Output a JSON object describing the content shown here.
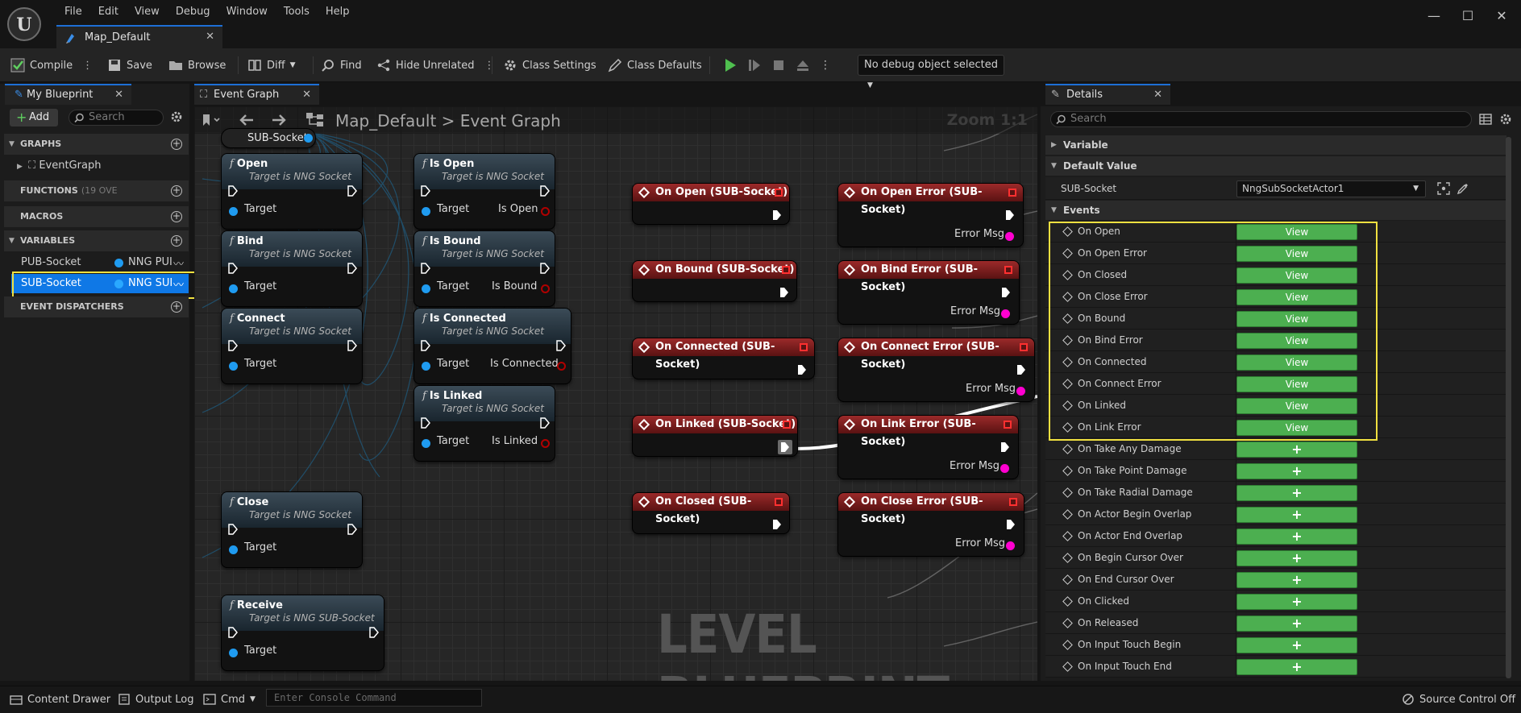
{
  "menu": [
    "File",
    "Edit",
    "View",
    "Debug",
    "Window",
    "Tools",
    "Help"
  ],
  "doc_tab": "Map_Default",
  "toolbar": {
    "compile": "Compile",
    "save": "Save",
    "browse": "Browse",
    "diff": "Diff",
    "find": "Find",
    "hide_unrelated": "Hide Unrelated",
    "class_settings": "Class Settings",
    "class_defaults": "Class Defaults",
    "debug_object": "No debug object selected"
  },
  "my_blueprint": {
    "tab": "My Blueprint",
    "add": "Add",
    "search_placeholder": "Search",
    "sections": {
      "graphs": "GRAPHS",
      "event_graph": "EventGraph",
      "functions": "FUNCTIONS",
      "functions_count": "(19 OVE",
      "macros": "MACROS",
      "variables": "VARIABLES",
      "dispatchers": "EVENT DISPATCHERS"
    },
    "variables": [
      {
        "name": "PUB-Socket",
        "type": "NNG PUI"
      },
      {
        "name": "SUB-Socket",
        "type": "NNG SUI"
      }
    ]
  },
  "graph": {
    "tab": "Event Graph",
    "breadcrumb_root": "Map_Default",
    "breadcrumb_sep": ">",
    "breadcrumb_leaf": "Event Graph",
    "zoom": "Zoom 1:1",
    "watermark": "LEVEL BLUEPRINT",
    "var_node": "SUB-Socket",
    "func_nodes": [
      {
        "title": "Open",
        "sub": "Target is NNG Socket",
        "pin": "Target"
      },
      {
        "title": "Bind",
        "sub": "Target is NNG Socket",
        "pin": "Target"
      },
      {
        "title": "Connect",
        "sub": "Target is NNG Socket",
        "pin": "Target"
      },
      {
        "title": "Close",
        "sub": "Target is NNG Socket",
        "pin": "Target"
      },
      {
        "title": "Receive",
        "sub": "Target is NNG SUB-Socket",
        "pin": "Target"
      }
    ],
    "query_nodes": [
      {
        "title": "Is Open",
        "sub": "Target is NNG Socket",
        "pin": "Target",
        "out": "Is Open"
      },
      {
        "title": "Is Bound",
        "sub": "Target is NNG Socket",
        "pin": "Target",
        "out": "Is Bound"
      },
      {
        "title": "Is Connected",
        "sub": "Target is NNG Socket",
        "pin": "Target",
        "out": "Is Connected"
      },
      {
        "title": "Is Linked",
        "sub": "Target is NNG Socket",
        "pin": "Target",
        "out": "Is Linked"
      }
    ],
    "event_nodes": [
      {
        "title": "On Open (SUB-Socket)"
      },
      {
        "title": "On Bound (SUB-Socket)"
      },
      {
        "title": "On Connected (SUB-Socket)"
      },
      {
        "title": "On Linked (SUB-Socket)"
      },
      {
        "title": "On Closed (SUB-Socket)"
      }
    ],
    "error_nodes": [
      {
        "title": "On Open Error (SUB-Socket)",
        "out": "Error Msg"
      },
      {
        "title": "On Bind Error (SUB-Socket)",
        "out": "Error Msg"
      },
      {
        "title": "On Connect Error (SUB-Socket)",
        "out": "Error Msg"
      },
      {
        "title": "On Link Error (SUB-Socket)",
        "out": "Error Msg"
      },
      {
        "title": "On Close Error (SUB-Socket)",
        "out": "Error Msg"
      }
    ]
  },
  "details": {
    "tab": "Details",
    "search_placeholder": "Search",
    "variable_section": "Variable",
    "default_value_section": "Default Value",
    "default_label": "SUB-Socket",
    "default_value": "NngSubSocketActor1",
    "events_section": "Events",
    "view_label": "View",
    "add_label": "+",
    "bound_events": [
      "On Open",
      "On Open Error",
      "On Closed",
      "On Close Error",
      "On Bound",
      "On Bind Error",
      "On Connected",
      "On Connect Error",
      "On Linked",
      "On Link Error"
    ],
    "other_events": [
      "On Take Any Damage",
      "On Take Point Damage",
      "On Take Radial Damage",
      "On Actor Begin Overlap",
      "On Actor End Overlap",
      "On Begin Cursor Over",
      "On End Cursor Over",
      "On Clicked",
      "On Released",
      "On Input Touch Begin",
      "On Input Touch End"
    ]
  },
  "status": {
    "content_drawer": "Content Drawer",
    "output_log": "Output Log",
    "cmd": "Cmd",
    "console_placeholder": "Enter Console Command",
    "source_control": "Source Control Off"
  },
  "colors": {
    "accent": "#1d6fd6",
    "highlight": "#f0e040",
    "view_button": "#4caf50",
    "object_pin": "#1f9bf0",
    "bool_pin": "#b00000",
    "string_pin": "#ff00d0",
    "event_header": "#8b1f1f"
  }
}
